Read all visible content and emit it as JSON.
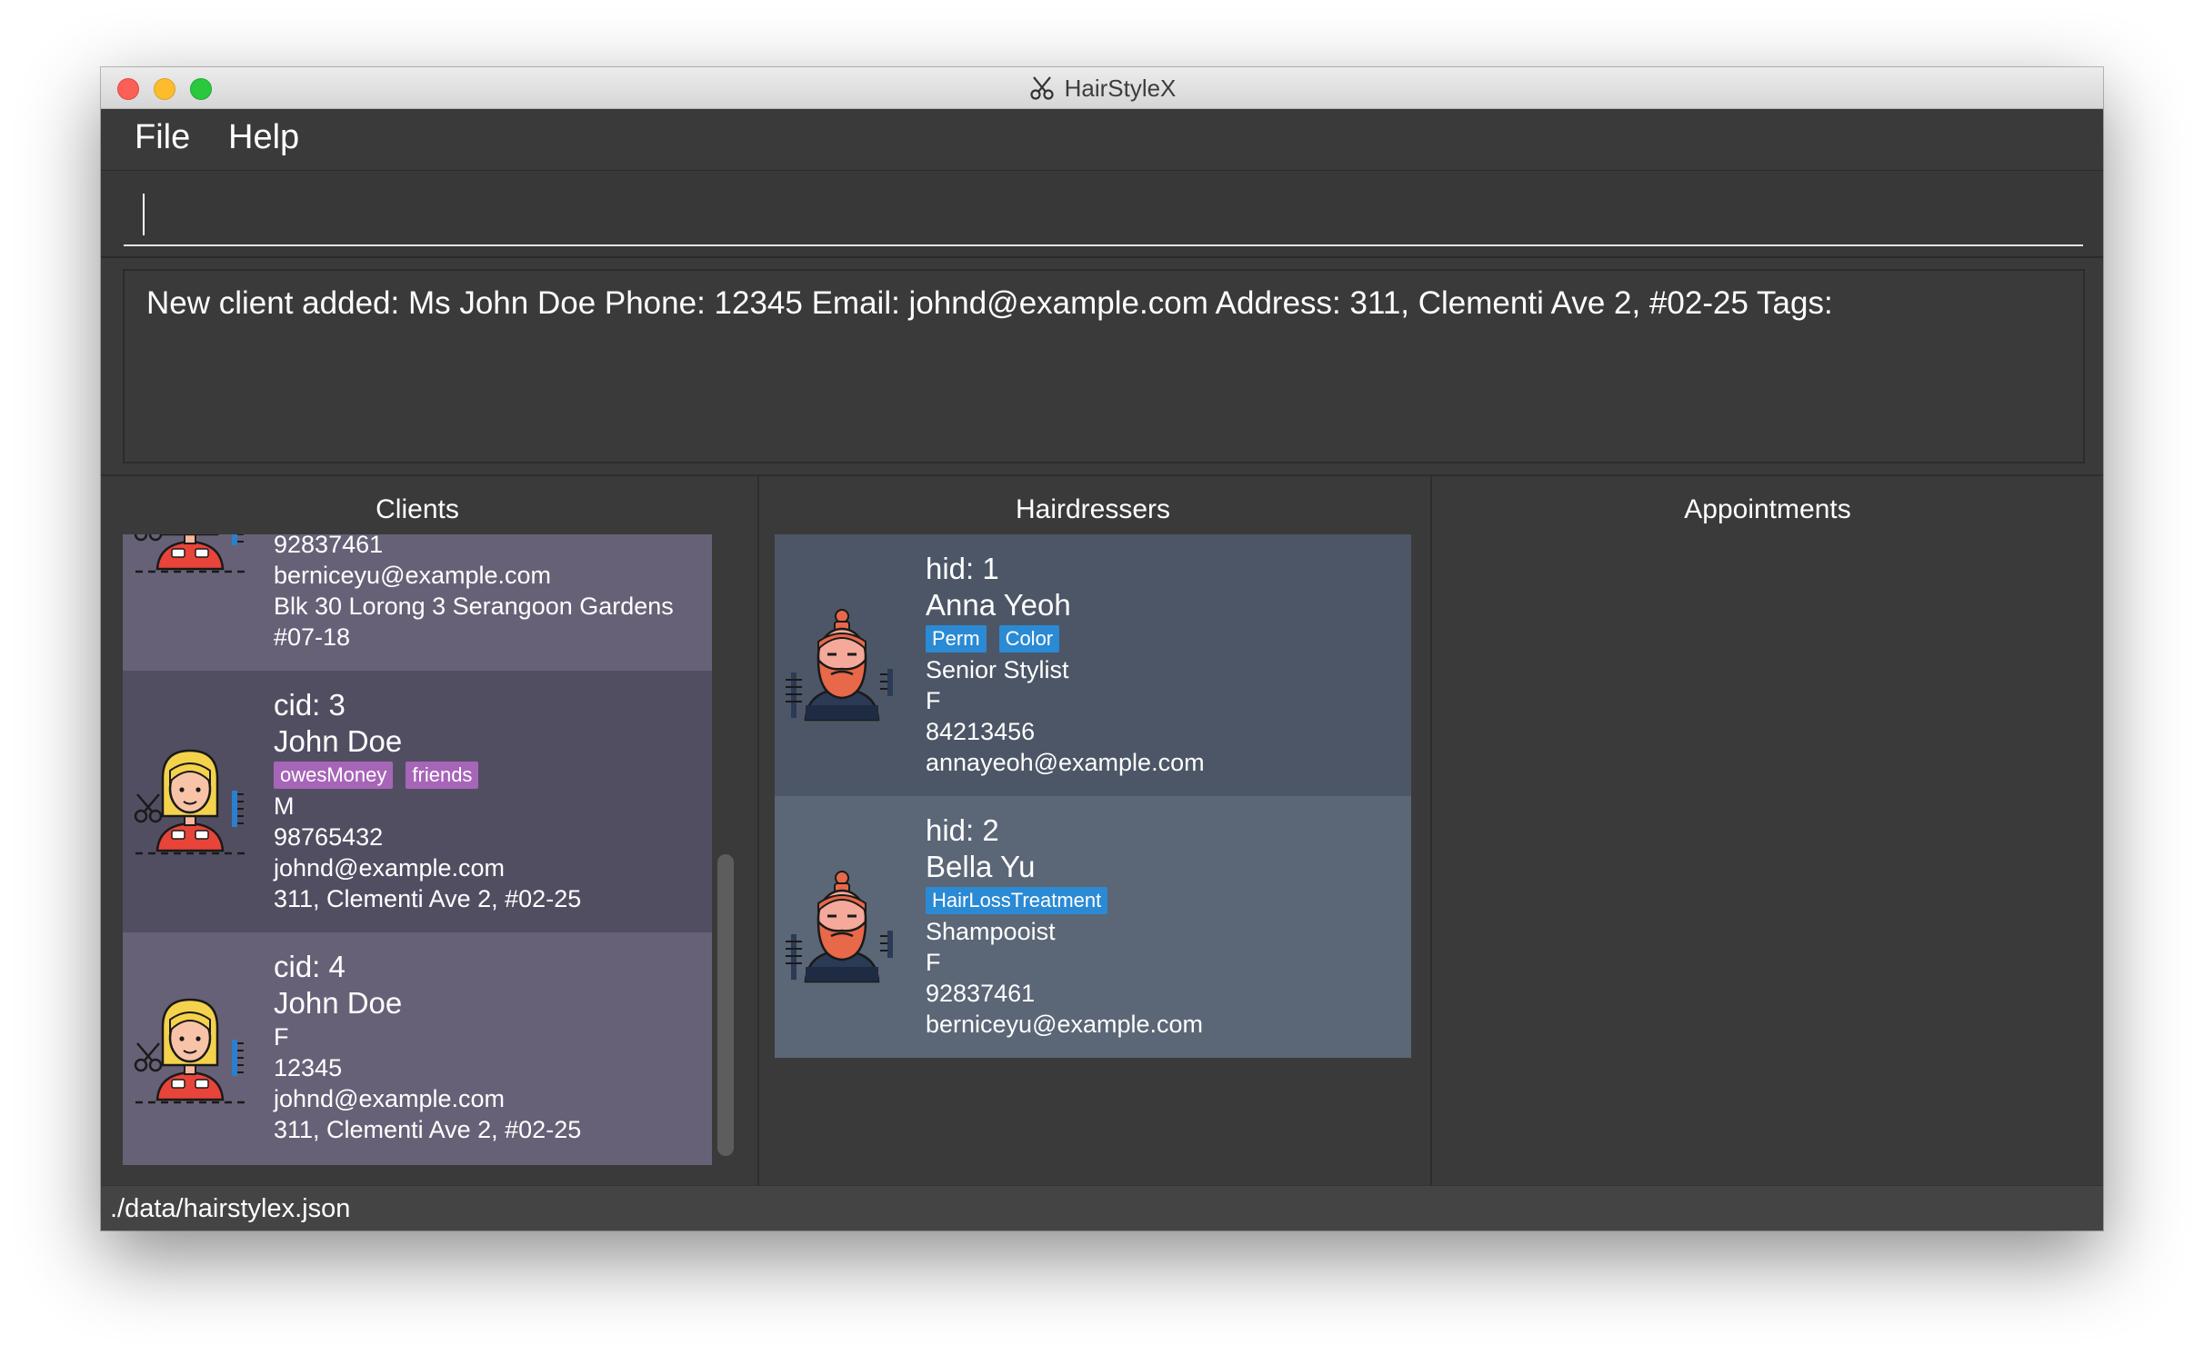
{
  "window": {
    "title": "HairStyleX"
  },
  "menu": {
    "items": [
      "File",
      "Help"
    ]
  },
  "command": {
    "value": "",
    "placeholder": ""
  },
  "result": {
    "message": "New client added: Ms John Doe Phone: 12345 Email: johnd@example.com Address: 311, Clementi Ave 2, #02-25 Tags:"
  },
  "panels": {
    "clients": "Clients",
    "hairdressers": "Hairdressers",
    "appointments": "Appointments"
  },
  "clients": [
    {
      "phone": "92837461",
      "email": "berniceyu@example.com",
      "address_line1": "Blk 30 Lorong 3 Serangoon Gardens",
      "address_line2": "#07-18"
    },
    {
      "id": "cid: 3",
      "name": "John Doe",
      "tags": [
        "owesMoney",
        "friends"
      ],
      "gender": "M",
      "phone": "98765432",
      "email": "johnd@example.com",
      "address": "311, Clementi Ave 2, #02-25"
    },
    {
      "id": "cid: 4",
      "name": "John Doe",
      "gender": "F",
      "phone": "12345",
      "email": "johnd@example.com",
      "address": "311, Clementi Ave 2, #02-25"
    }
  ],
  "hairdressers": [
    {
      "id": "hid: 1",
      "name": "Anna Yeoh",
      "specialisations": [
        "Perm",
        "Color"
      ],
      "title": "Senior Stylist",
      "gender": "F",
      "phone": "84213456",
      "email": "annayeoh@example.com"
    },
    {
      "id": "hid: 2",
      "name": "Bella Yu",
      "specialisations": [
        "HairLossTreatment"
      ],
      "title": "Shampooist",
      "gender": "F",
      "phone": "92837461",
      "email": "berniceyu@example.com"
    }
  ],
  "status": {
    "path": "./data/hairstylex.json"
  },
  "colors": {
    "background": "#3a3a3a",
    "client_card_light": "#676177",
    "client_card_dark": "#524e62",
    "hairdresser_card_dark": "#4c5666",
    "hairdresser_card_light": "#5b6676",
    "client_tag": "#a765b8",
    "hairdresser_tag": "#2b8ad4"
  },
  "icons": {
    "title": "scissors-icon",
    "client_avatar": "female-client-avatar-icon",
    "hairdresser_avatar": "bearded-hairdresser-avatar-icon"
  }
}
